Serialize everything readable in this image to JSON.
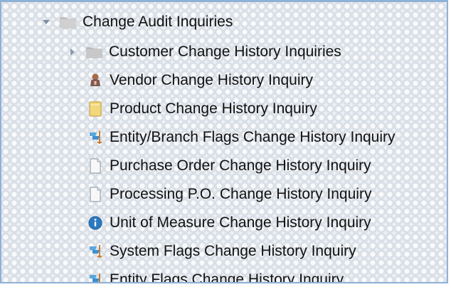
{
  "tree": {
    "root": {
      "label": "Change Audit Inquiries",
      "expanded": true,
      "icon": "folder-open-icon"
    },
    "children": [
      {
        "label": "Customer Change History Inquiries",
        "type": "folder",
        "expanded": false,
        "icon": "folder-icon"
      },
      {
        "label": "Vendor Change History Inquiry",
        "type": "item",
        "icon": "vendor-person-icon"
      },
      {
        "label": "Product Change History Inquiry",
        "type": "item",
        "icon": "note-icon"
      },
      {
        "label": "Entity/Branch Flags Change History Inquiry",
        "type": "item",
        "icon": "flags-icon"
      },
      {
        "label": "Purchase Order Change History Inquiry",
        "type": "item",
        "icon": "document-icon"
      },
      {
        "label": "Processing P.O. Change History Inquiry",
        "type": "item",
        "icon": "document-icon"
      },
      {
        "label": "Unit of Measure Change History Inquiry",
        "type": "item",
        "icon": "info-icon"
      },
      {
        "label": "System Flags Change History Inquiry",
        "type": "item",
        "icon": "flags-icon"
      },
      {
        "label": "Entity Flags Change History Inquiry",
        "type": "item",
        "icon": "flags-icon"
      }
    ]
  },
  "colors": {
    "frame_border": "#8fb1d6",
    "background": "#eef1f5",
    "text": "#111111",
    "folder": "#bdbdbd",
    "note": "#f3d77b",
    "flag": "#58a7df",
    "info": "#2b79c2"
  }
}
